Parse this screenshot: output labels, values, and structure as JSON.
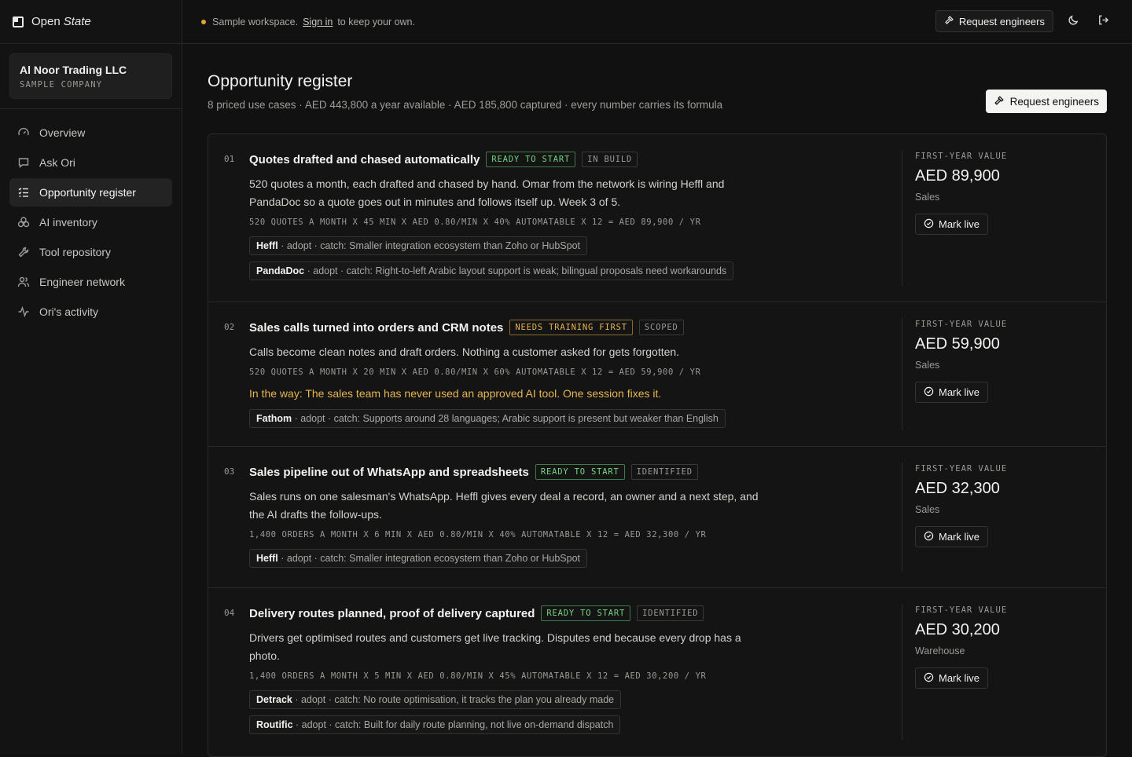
{
  "brand": {
    "name": "Open",
    "name_italic": "State"
  },
  "company": {
    "name": "Al Noor Trading LLC",
    "sub": "SAMPLE COMPANY"
  },
  "nav": [
    {
      "label": "Overview",
      "icon": "gauge-icon"
    },
    {
      "label": "Ask Ori",
      "icon": "chat-icon"
    },
    {
      "label": "Opportunity register",
      "icon": "checklist-icon",
      "active": true
    },
    {
      "label": "AI inventory",
      "icon": "cubes-icon"
    },
    {
      "label": "Tool repository",
      "icon": "wrench-icon"
    },
    {
      "label": "Engineer network",
      "icon": "users-icon"
    },
    {
      "label": "Ori's activity",
      "icon": "activity-icon"
    }
  ],
  "topbar": {
    "notice_prefix": "Sample workspace.",
    "signin": "Sign in",
    "notice_suffix": "to keep your own.",
    "request_label": "Request engineers"
  },
  "page": {
    "title": "Opportunity register",
    "subtitle": "8 priced use cases · AED 443,800 a year available · AED 185,800 captured · every number carries its formula",
    "request_label": "Request engineers"
  },
  "value_label": "FIRST-YEAR VALUE",
  "mark_live_label": "Mark live",
  "rows": [
    {
      "num": "01",
      "title": "Quotes drafted and chased automatically",
      "status": "READY TO START",
      "stage": "IN BUILD",
      "desc": "520 quotes a month, each drafted and chased by hand. Omar from the network is wiring Heffl and PandaDoc so a quote goes out in minutes and follows itself up. Week 3 of 5.",
      "formula": "520 QUOTES A MONTH X 45 MIN X AED 0.80/MIN X 40% AUTOMATABLE X 12 = AED 89,900 / YR",
      "tools": [
        {
          "name": "Heffl",
          "note": " · adopt · catch: Smaller integration ecosystem than Zoho or HubSpot"
        },
        {
          "name": "PandaDoc",
          "note": " · adopt · catch: Right-to-left Arabic layout support is weak; bilingual proposals need workarounds"
        }
      ],
      "amount": "AED 89,900",
      "dept": "Sales"
    },
    {
      "num": "02",
      "title": "Sales calls turned into orders and CRM notes",
      "status": "NEEDS TRAINING FIRST",
      "stage": "SCOPED",
      "desc": "Calls become clean notes and draft orders. Nothing a customer asked for gets forgotten.",
      "formula": "520 QUOTES A MONTH X 20 MIN X AED 0.80/MIN X 60% AUTOMATABLE X 12 = AED 59,900 / YR",
      "warn": "In the way: The sales team has never used an approved AI tool. One session fixes it.",
      "tools": [
        {
          "name": "Fathom",
          "note": " · adopt · catch: Supports around 28 languages; Arabic support is present but weaker than English"
        }
      ],
      "amount": "AED 59,900",
      "dept": "Sales"
    },
    {
      "num": "03",
      "title": "Sales pipeline out of WhatsApp and spreadsheets",
      "status": "READY TO START",
      "stage": "IDENTIFIED",
      "desc": "Sales runs on one salesman's WhatsApp. Heffl gives every deal a record, an owner and a next step, and the AI drafts the follow-ups.",
      "formula": "1,400 ORDERS A MONTH X 6 MIN X AED 0.80/MIN X 40% AUTOMATABLE X 12 = AED 32,300 / YR",
      "tools": [
        {
          "name": "Heffl",
          "note": " · adopt · catch: Smaller integration ecosystem than Zoho or HubSpot"
        }
      ],
      "amount": "AED 32,300",
      "dept": "Sales"
    },
    {
      "num": "04",
      "title": "Delivery routes planned, proof of delivery captured",
      "status": "READY TO START",
      "stage": "IDENTIFIED",
      "desc": "Drivers get optimised routes and customers get live tracking. Disputes end because every drop has a photo.",
      "formula": "1,400 ORDERS A MONTH X 5 MIN X AED 0.80/MIN X 45% AUTOMATABLE X 12 = AED 30,200 / YR",
      "tools": [
        {
          "name": "Detrack",
          "note": " · adopt · catch: No route optimisation, it tracks the plan you already made"
        },
        {
          "name": "Routific",
          "note": " · adopt · catch: Built for daily route planning, not live on-demand dispatch"
        }
      ],
      "amount": "AED 30,200",
      "dept": "Warehouse"
    }
  ]
}
